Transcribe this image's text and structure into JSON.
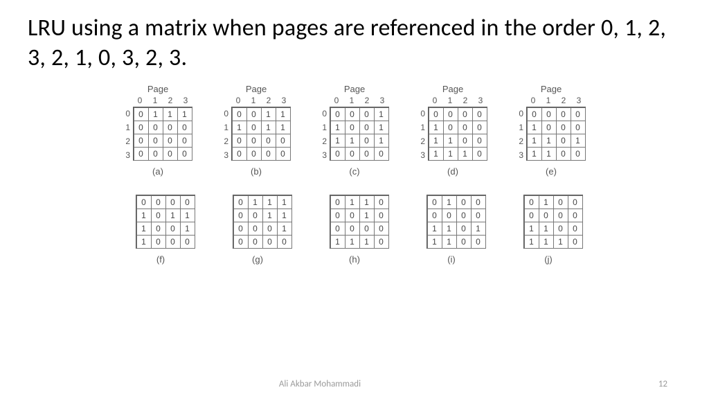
{
  "title": "LRU using a matrix when pages are referenced in the order 0, 1, 2, 3, 2, 1, 0, 3, 2, 3.",
  "page_label": "Page",
  "col_headers": [
    "0",
    "1",
    "2",
    "3"
  ],
  "row_headers": [
    "0",
    "1",
    "2",
    "3"
  ],
  "footer": {
    "author": "Ali Akbar Mohammadi",
    "page": "12"
  },
  "matrices_row1": [
    {
      "caption": "(a)",
      "show_headers": true,
      "data": [
        [
          0,
          1,
          1,
          1
        ],
        [
          0,
          0,
          0,
          0
        ],
        [
          0,
          0,
          0,
          0
        ],
        [
          0,
          0,
          0,
          0
        ]
      ]
    },
    {
      "caption": "(b)",
      "show_headers": true,
      "data": [
        [
          0,
          0,
          1,
          1
        ],
        [
          1,
          0,
          1,
          1
        ],
        [
          0,
          0,
          0,
          0
        ],
        [
          0,
          0,
          0,
          0
        ]
      ]
    },
    {
      "caption": "(c)",
      "show_headers": true,
      "data": [
        [
          0,
          0,
          0,
          1
        ],
        [
          1,
          0,
          0,
          1
        ],
        [
          1,
          1,
          0,
          1
        ],
        [
          0,
          0,
          0,
          0
        ]
      ]
    },
    {
      "caption": "(d)",
      "show_headers": true,
      "data": [
        [
          0,
          0,
          0,
          0
        ],
        [
          1,
          0,
          0,
          0
        ],
        [
          1,
          1,
          0,
          0
        ],
        [
          1,
          1,
          1,
          0
        ]
      ]
    },
    {
      "caption": "(e)",
      "show_headers": true,
      "data": [
        [
          0,
          0,
          0,
          0
        ],
        [
          1,
          0,
          0,
          0
        ],
        [
          1,
          1,
          0,
          1
        ],
        [
          1,
          1,
          0,
          0
        ]
      ]
    }
  ],
  "matrices_row2": [
    {
      "caption": "(f)",
      "show_headers": false,
      "data": [
        [
          0,
          0,
          0,
          0
        ],
        [
          1,
          0,
          1,
          1
        ],
        [
          1,
          0,
          0,
          1
        ],
        [
          1,
          0,
          0,
          0
        ]
      ]
    },
    {
      "caption": "(g)",
      "show_headers": false,
      "data": [
        [
          0,
          1,
          1,
          1
        ],
        [
          0,
          0,
          1,
          1
        ],
        [
          0,
          0,
          0,
          1
        ],
        [
          0,
          0,
          0,
          0
        ]
      ]
    },
    {
      "caption": "(h)",
      "show_headers": false,
      "data": [
        [
          0,
          1,
          1,
          0
        ],
        [
          0,
          0,
          1,
          0
        ],
        [
          0,
          0,
          0,
          0
        ],
        [
          1,
          1,
          1,
          0
        ]
      ]
    },
    {
      "caption": "(i)",
      "show_headers": false,
      "data": [
        [
          0,
          1,
          0,
          0
        ],
        [
          0,
          0,
          0,
          0
        ],
        [
          1,
          1,
          0,
          1
        ],
        [
          1,
          1,
          0,
          0
        ]
      ]
    },
    {
      "caption": "(j)",
      "show_headers": false,
      "data": [
        [
          0,
          1,
          0,
          0
        ],
        [
          0,
          0,
          0,
          0
        ],
        [
          1,
          1,
          0,
          0
        ],
        [
          1,
          1,
          1,
          0
        ]
      ]
    }
  ]
}
